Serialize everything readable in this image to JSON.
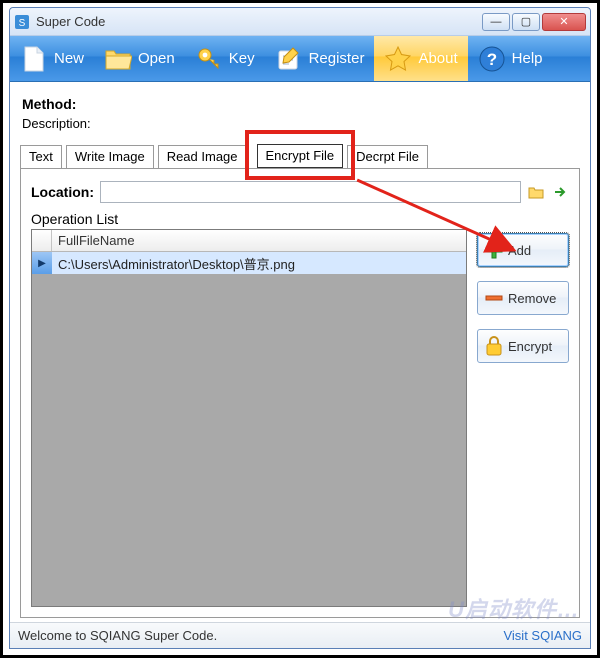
{
  "window": {
    "title": "Super Code"
  },
  "toolbar": {
    "new": "New",
    "open": "Open",
    "key": "Key",
    "register": "Register",
    "about": "About",
    "help": "Help"
  },
  "method": {
    "label": "Method:",
    "description_label": "Description:"
  },
  "tabs": {
    "text": "Text",
    "write_image": "Write Image",
    "read_image": "Read Image",
    "encrypt_file": "Encrypt File",
    "decrypt_file": "Decrpt File"
  },
  "encrypt_panel": {
    "location_label": "Location:",
    "location_value": "",
    "operation_list_label": "Operation List",
    "column_header": "FullFileName",
    "rows": [
      "C:\\Users\\Administrator\\Desktop\\普京.png"
    ],
    "buttons": {
      "add": "Add",
      "remove": "Remove",
      "encrypt": "Encrypt"
    }
  },
  "status": {
    "welcome": "Welcome to SQIANG Super Code.",
    "link": "Visit SQIANG"
  },
  "watermark": "U启动软件…",
  "colors": {
    "annotation": "#e2231a"
  }
}
